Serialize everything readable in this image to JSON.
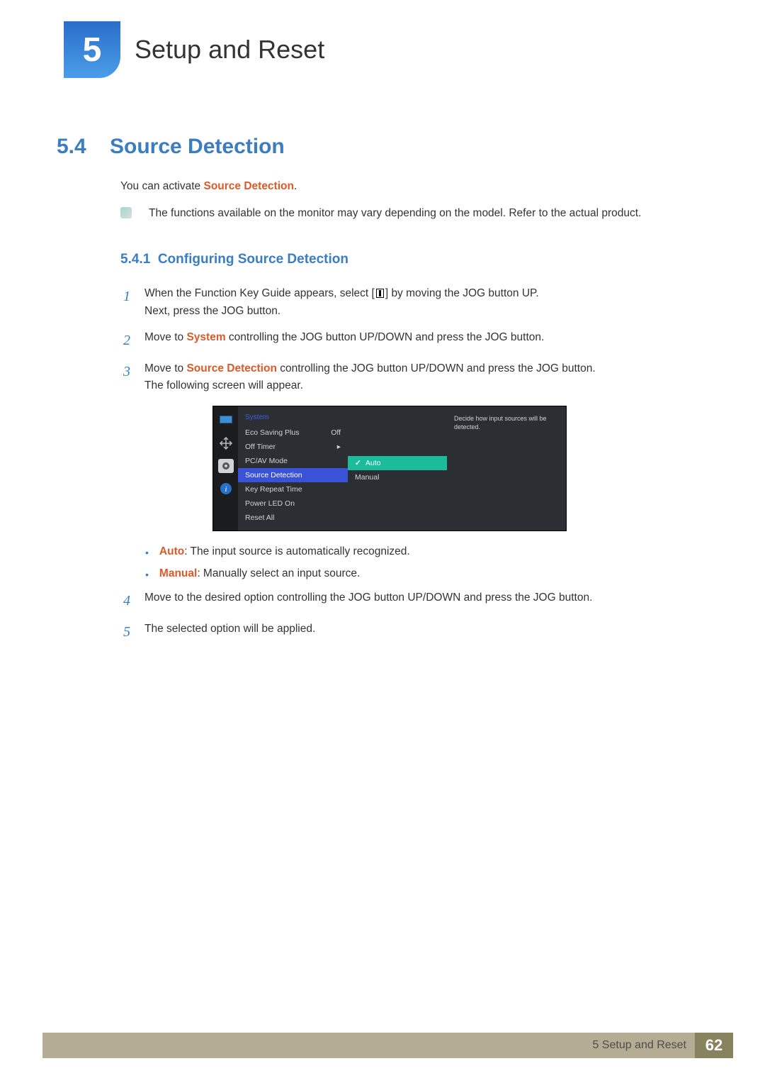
{
  "chapter": {
    "number": "5",
    "title": "Setup and Reset"
  },
  "section": {
    "number": "5.4",
    "title": "Source Detection"
  },
  "intro": {
    "pre": "You can activate ",
    "term": "Source Detection",
    "post": "."
  },
  "note": "The functions available on the monitor may vary depending on the model. Refer to the actual product.",
  "subsection": {
    "number": "5.4.1",
    "title": "Configuring Source Detection"
  },
  "steps": {
    "s1": {
      "num": "1",
      "line1_pre": "When the Function Key Guide appears, select [",
      "line1_post": "] by moving the JOG button UP.",
      "line2": "Next, press the JOG button."
    },
    "s2": {
      "num": "2",
      "pre": "Move to ",
      "term": "System",
      "post": " controlling the JOG button UP/DOWN and press the JOG button."
    },
    "s3": {
      "num": "3",
      "pre": "Move to ",
      "term": "Source Detection",
      "post": " controlling the JOG button UP/DOWN and press the JOG button.",
      "line2": "The following screen will appear."
    },
    "s4": {
      "num": "4",
      "text": "Move to the desired option controlling the JOG button UP/DOWN and press the JOG button."
    },
    "s5": {
      "num": "5",
      "text": "The selected option will be applied."
    }
  },
  "osd": {
    "title": "System",
    "items": {
      "eco": "Eco Saving Plus",
      "eco_val": "Off",
      "offtimer": "Off Timer",
      "offtimer_val": "▸",
      "pcav": "PC/AV Mode",
      "source": "Source Detection",
      "keyrepeat": "Key Repeat Time",
      "powerled": "Power LED On",
      "resetall": "Reset All"
    },
    "options": {
      "auto": "Auto",
      "manual": "Manual"
    },
    "hint": "Decide how input sources will be detected."
  },
  "bullets": {
    "auto_label": "Auto",
    "auto_text": ": The input source is automatically recognized.",
    "manual_label": "Manual",
    "manual_text": ": Manually select an input source."
  },
  "footer": {
    "text": "5 Setup and Reset",
    "page": "62"
  }
}
